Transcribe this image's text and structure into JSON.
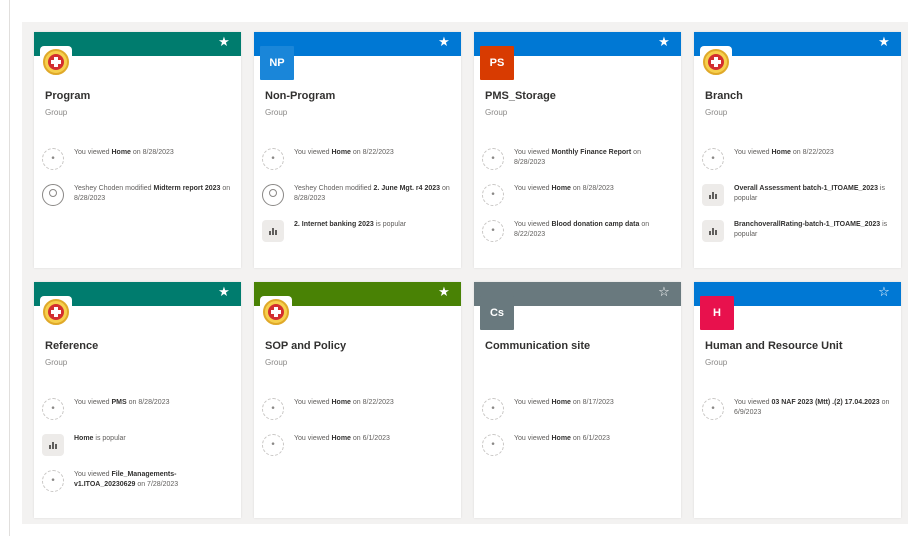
{
  "cards": [
    {
      "title": "Program",
      "subtitle": "Group",
      "banner_color": "#007c6e",
      "logo": "emblem",
      "starred": true,
      "activities": [
        {
          "icon": "view",
          "pre": "You viewed ",
          "bold": "Home",
          "post": " on 8/28/2023"
        },
        {
          "icon": "person",
          "pre": "Yeshey Choden modified ",
          "bold": "Midterm report 2023",
          "post": " on 8/28/2023"
        }
      ]
    },
    {
      "title": "Non-Program",
      "subtitle": "Group",
      "banner_color": "#0078d4",
      "logo": "initials",
      "initials": "NP",
      "logo_color": "#1a86d9",
      "starred": true,
      "activities": [
        {
          "icon": "view",
          "pre": "You viewed ",
          "bold": "Home",
          "post": " on 8/22/2023"
        },
        {
          "icon": "person",
          "pre": "Yeshey Choden modified ",
          "bold": "2. June Mgt. r4 2023",
          "post": " on 8/28/2023"
        },
        {
          "icon": "chart",
          "pre": "",
          "bold": "2. Internet banking 2023",
          "post": " is popular"
        }
      ]
    },
    {
      "title": "PMS_Storage",
      "subtitle": "Group",
      "banner_color": "#0078d4",
      "logo": "initials",
      "initials": "PS",
      "logo_color": "#d83b01",
      "starred": true,
      "activities": [
        {
          "icon": "view",
          "pre": "You viewed ",
          "bold": "Monthly Finance Report",
          "post": " on 8/28/2023"
        },
        {
          "icon": "view",
          "pre": "You viewed ",
          "bold": "Home",
          "post": " on 8/28/2023"
        },
        {
          "icon": "view",
          "pre": "You viewed ",
          "bold": "Blood donation camp data",
          "post": " on 8/22/2023"
        }
      ]
    },
    {
      "title": "Branch",
      "subtitle": "Group",
      "banner_color": "#0078d4",
      "logo": "emblem",
      "starred": true,
      "activities": [
        {
          "icon": "view",
          "pre": "You viewed ",
          "bold": "Home",
          "post": " on 8/22/2023"
        },
        {
          "icon": "chart",
          "pre": "",
          "bold": "Overall Assessment batch-1_ITOAME_2023",
          "post": " is popular"
        },
        {
          "icon": "chart",
          "pre": "",
          "bold": "BranchoverallRating-batch-1_ITOAME_2023",
          "post": " is popular"
        }
      ]
    },
    {
      "title": "Reference",
      "subtitle": "Group",
      "banner_color": "#007c6e",
      "logo": "emblem",
      "starred": true,
      "activities": [
        {
          "icon": "view",
          "pre": "You viewed ",
          "bold": "PMS",
          "post": " on 8/28/2023"
        },
        {
          "icon": "chart",
          "pre": "",
          "bold": "Home",
          "post": " is popular"
        },
        {
          "icon": "view",
          "pre": "You viewed ",
          "bold": "File_Managements-v1.ITOA_20230629",
          "post": " on 7/28/2023"
        }
      ]
    },
    {
      "title": "SOP and Policy",
      "subtitle": "Group",
      "banner_color": "#498205",
      "logo": "emblem",
      "starred": true,
      "activities": [
        {
          "icon": "view",
          "pre": "You viewed ",
          "bold": "Home",
          "post": " on 8/22/2023"
        },
        {
          "icon": "view",
          "pre": "You viewed ",
          "bold": "Home",
          "post": " on 6/1/2023"
        }
      ]
    },
    {
      "title": "Communication site",
      "subtitle": "",
      "banner_color": "#69797e",
      "logo": "initials",
      "initials": "Cs",
      "logo_color": "#69797e",
      "starred": false,
      "activities": [
        {
          "icon": "view",
          "pre": "You viewed ",
          "bold": "Home",
          "post": " on 8/17/2023"
        },
        {
          "icon": "view",
          "pre": "You viewed ",
          "bold": "Home",
          "post": " on 6/1/2023"
        }
      ]
    },
    {
      "title": "Human and Resource Unit",
      "subtitle": "Group",
      "banner_color": "#0078d4",
      "logo": "initials",
      "initials": "H",
      "logo_color": "#e8114d",
      "starred": false,
      "activities": [
        {
          "icon": "view",
          "pre": "You viewed ",
          "bold": "03 NAF 2023 (Mtt) .(2) 17.04.2023",
          "post": " on 6/9/2023"
        }
      ]
    }
  ],
  "icons": {
    "star_filled": "star-filled-icon",
    "star_outline": "star-outline-icon",
    "view": "view-icon",
    "person": "person-icon",
    "chart": "chart-icon"
  }
}
